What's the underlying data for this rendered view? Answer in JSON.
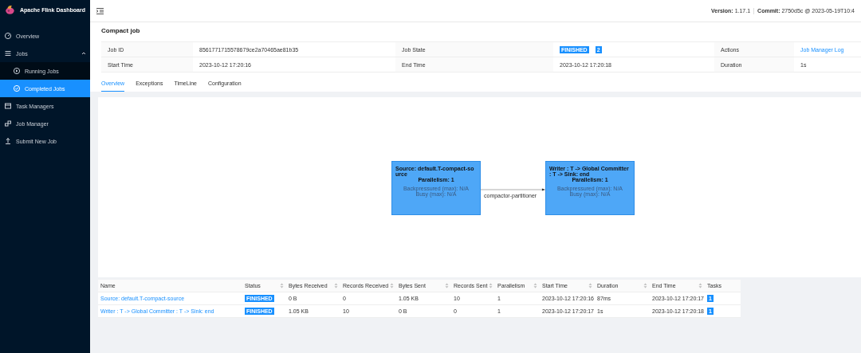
{
  "sidebar": {
    "title": "Apache Flink Dashboard",
    "items": [
      {
        "label": "Overview",
        "kind": "link",
        "selected": false
      },
      {
        "label": "Jobs",
        "kind": "group",
        "expanded": true,
        "children": [
          {
            "label": "Running Jobs",
            "selected": false
          },
          {
            "label": "Completed Jobs",
            "selected": true
          }
        ]
      },
      {
        "label": "Task Managers",
        "kind": "link",
        "selected": false
      },
      {
        "label": "Job Manager",
        "kind": "link",
        "selected": false
      },
      {
        "label": "Submit New Job",
        "kind": "link",
        "selected": false
      }
    ]
  },
  "header": {
    "version_label": "Version:",
    "version": "1.17.1",
    "commit_label": "Commit:",
    "commit": "2750d5c @ 2023-05-19T10:4"
  },
  "job": {
    "title": "Compact job",
    "info": [
      {
        "label": "Job ID",
        "value": "8561771715578679ce2a70465ae81b35"
      },
      {
        "label": "Job State",
        "status": "FINISHED",
        "tasks": "2"
      },
      {
        "label": "Actions",
        "link": "Job Manager Log"
      },
      {
        "label": "Start Time",
        "value": "2023-10-12 17:20:16"
      },
      {
        "label": "End Time",
        "value": "2023-10-12 17:20:18"
      },
      {
        "label": "Duration",
        "value": "1s"
      }
    ]
  },
  "tabs": [
    {
      "label": "Overview",
      "selected": true
    },
    {
      "label": "Exceptions",
      "selected": false
    },
    {
      "label": "TimeLine",
      "selected": false
    },
    {
      "label": "Configuration",
      "selected": false
    }
  ],
  "graph": {
    "nodes": [
      {
        "name": "Source: default.T-compact-source",
        "parallelism": "Parallelism: 1",
        "backpressure": "Backpressured (max): N/A",
        "busy": "Busy (max): N/A"
      },
      {
        "name": "Writer : T -> Global Committer : T -> Sink: end",
        "parallelism": "Parallelism: 1",
        "backpressure": "Backpressured (max): N/A",
        "busy": "Busy (max): N/A"
      }
    ],
    "edge_label": "compactor-partitioner"
  },
  "table": {
    "columns": [
      "Name",
      "Status",
      "Bytes Received",
      "Records Received",
      "Bytes Sent",
      "Records Sent",
      "Parallelism",
      "Start Time",
      "Duration",
      "End Time",
      "Tasks"
    ],
    "rows": [
      {
        "name": "Source: default.T-compact-source",
        "status": "FINISHED",
        "bytes_received": "0 B",
        "records_received": "0",
        "bytes_sent": "1.05 KB",
        "records_sent": "10",
        "parallelism": "1",
        "start_time": "2023-10-12 17:20:16",
        "duration": "87ms",
        "end_time": "2023-10-12 17:20:17",
        "tasks": "1"
      },
      {
        "name": "Writer : T -> Global Committer : T -> Sink: end",
        "status": "FINISHED",
        "bytes_received": "1.05 KB",
        "records_received": "10",
        "bytes_sent": "0 B",
        "records_sent": "0",
        "parallelism": "1",
        "start_time": "2023-10-12 17:20:17",
        "duration": "1s",
        "end_time": "2023-10-12 17:20:18",
        "tasks": "1"
      }
    ]
  }
}
